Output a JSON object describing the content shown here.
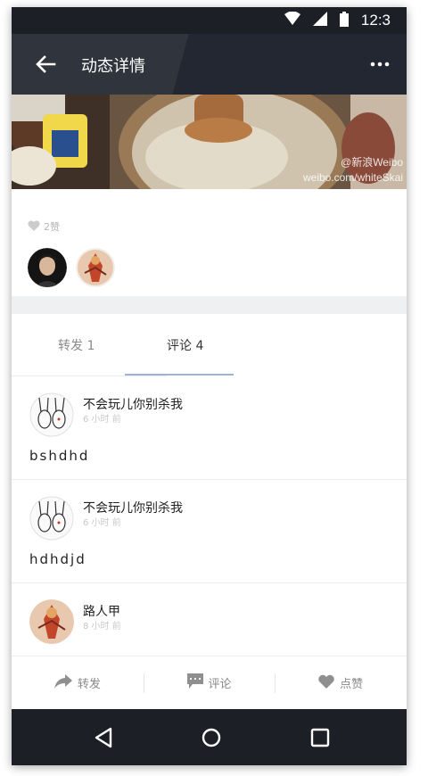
{
  "status_bar": {
    "time": "12:3",
    "icons": [
      "wifi-icon",
      "signal-icon",
      "battery-icon"
    ]
  },
  "app_bar": {
    "title": "动态详情",
    "back_icon": "arrow-left-icon",
    "more_icon": "more-dots-icon"
  },
  "hero": {
    "watermark_top": "@新浪Weibo",
    "watermark_bottom": "weibo.com/whiteSkai"
  },
  "likes": {
    "count_label": "2赞",
    "icon": "heart-icon"
  },
  "tabs": [
    {
      "label": "转发 1",
      "active": false
    },
    {
      "label": "评论 4",
      "active": true
    }
  ],
  "comments": [
    {
      "name": "不会玩儿你别杀我",
      "time": "6 小时 前",
      "body": "bshdhd",
      "avatar": "rabbit-sketch"
    },
    {
      "name": "不会玩儿你别杀我",
      "time": "6 小时 前",
      "body": "hdhdjd",
      "avatar": "rabbit-sketch"
    },
    {
      "name": "路人甲",
      "time": "8 小时 前",
      "body": "",
      "avatar": "warrior-art"
    }
  ],
  "action_bar": {
    "repost_label": "转发",
    "comment_label": "评论",
    "like_label": "点赞"
  },
  "nav_bar": {
    "icons": [
      "back-triangle-icon",
      "home-circle-icon",
      "recents-square-icon"
    ]
  },
  "colors": {
    "app_bar": "#232731",
    "status_bar": "#1c1f26",
    "tab_underline": "#9fb2d9",
    "muted_text": "#8a8a8a"
  }
}
